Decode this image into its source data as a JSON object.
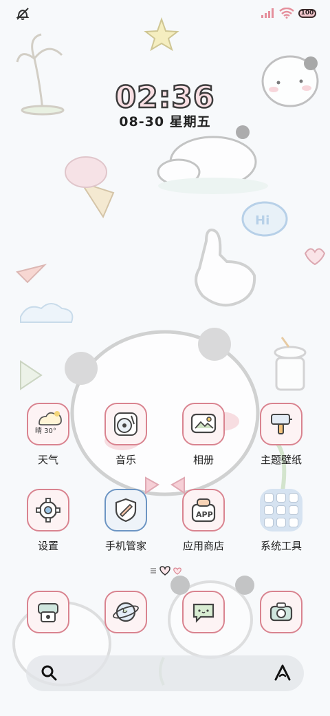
{
  "status_bar": {
    "left_icon": "notification-muted-icon",
    "signal_icon": "signal-icon",
    "wifi_icon": "wifi-icon",
    "battery_level": "100"
  },
  "lockscreen": {
    "time": "02:36",
    "date": "08-30 星期五"
  },
  "apps_row1": [
    {
      "label": "天气",
      "icon": "weather-icon",
      "weather_text": "晴 30°"
    },
    {
      "label": "音乐",
      "icon": "music-icon"
    },
    {
      "label": "相册",
      "icon": "gallery-icon"
    },
    {
      "label": "主题壁纸",
      "icon": "theme-brush-icon"
    }
  ],
  "apps_row2": [
    {
      "label": "设置",
      "icon": "settings-gear-icon"
    },
    {
      "label": "手机管家",
      "icon": "phone-manager-shield-icon"
    },
    {
      "label": "应用商店",
      "icon": "app-store-icon"
    },
    {
      "label": "系统工具",
      "icon": "folder-icon"
    }
  ],
  "dock": [
    {
      "icon": "phone-icon"
    },
    {
      "icon": "browser-globe-icon"
    },
    {
      "icon": "messages-icon"
    },
    {
      "icon": "camera-icon"
    }
  ],
  "search_bar": {
    "search_icon": "search-icon",
    "assistant_icon": "assistant-icon"
  },
  "colors": {
    "icon_border": "#d9838f",
    "icon_bg": "#fdf3f4",
    "accent_pink": "#f6c9cf",
    "blue_border": "#6c95c3"
  }
}
